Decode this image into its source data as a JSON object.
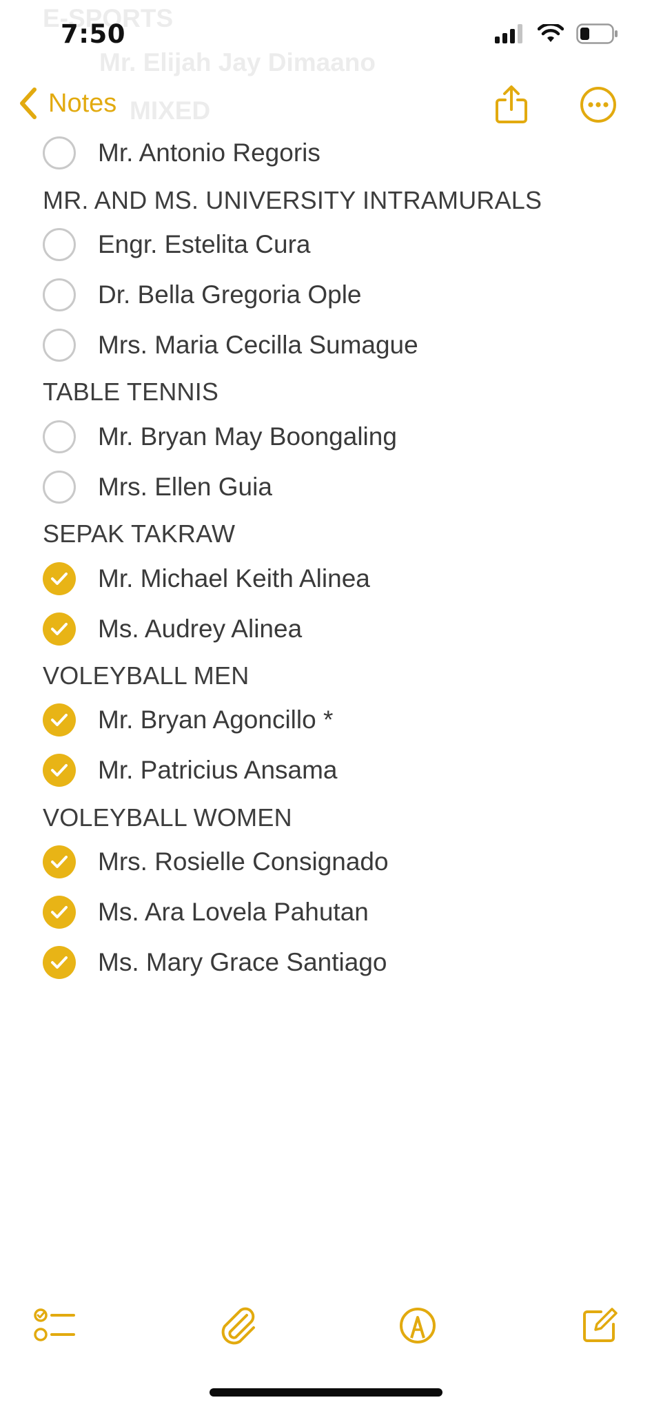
{
  "status_bar": {
    "time": "7:50"
  },
  "nav": {
    "back_label": "Notes"
  },
  "ghost_lines": [
    "E-SPORTS",
    "Mr. Elijah Jay Dimaano",
    "MIXED"
  ],
  "sections": [
    {
      "heading": "",
      "items": [
        {
          "text": "Mr. Antonio Regoris",
          "checked": false
        }
      ]
    },
    {
      "heading": "MR. AND MS. UNIVERSITY INTRAMURALS",
      "items": [
        {
          "text": "Engr. Estelita Cura",
          "checked": false
        },
        {
          "text": "Dr. Bella Gregoria Ople",
          "checked": false
        },
        {
          "text": "Mrs. Maria Cecilla Sumague",
          "checked": false
        }
      ]
    },
    {
      "heading": "TABLE TENNIS",
      "items": [
        {
          "text": "Mr. Bryan May Boongaling",
          "checked": false
        },
        {
          "text": "Mrs. Ellen Guia",
          "checked": false
        }
      ]
    },
    {
      "heading": "SEPAK TAKRAW",
      "items": [
        {
          "text": "Mr. Michael Keith Alinea",
          "checked": true
        },
        {
          "text": "Ms. Audrey Alinea",
          "checked": true
        }
      ]
    },
    {
      "heading": "VOLEYBALL MEN",
      "items": [
        {
          "text": "Mr. Bryan Agoncillo *",
          "checked": true
        },
        {
          "text": "Mr. Patricius Ansama",
          "checked": true
        }
      ]
    },
    {
      "heading": "VOLEYBALL WOMEN",
      "items": [
        {
          "text": "Mrs. Rosielle Consignado",
          "checked": true
        },
        {
          "text": "Ms. Ara Lovela Pahutan",
          "checked": true
        },
        {
          "text": "Ms. Mary Grace Santiago",
          "checked": true
        }
      ]
    }
  ],
  "icons": {
    "back": "chevron-left-icon",
    "share": "share-icon",
    "more": "ellipsis-circle-icon",
    "checklist": "checklist-icon",
    "attach": "paperclip-icon",
    "markup": "markup-pen-icon",
    "compose": "compose-icon"
  },
  "colors": {
    "accent": "#e2aa0f",
    "checked_fill": "#e8b416",
    "unchecked_ring": "#c9c9c9",
    "text": "#3a3a3a"
  }
}
